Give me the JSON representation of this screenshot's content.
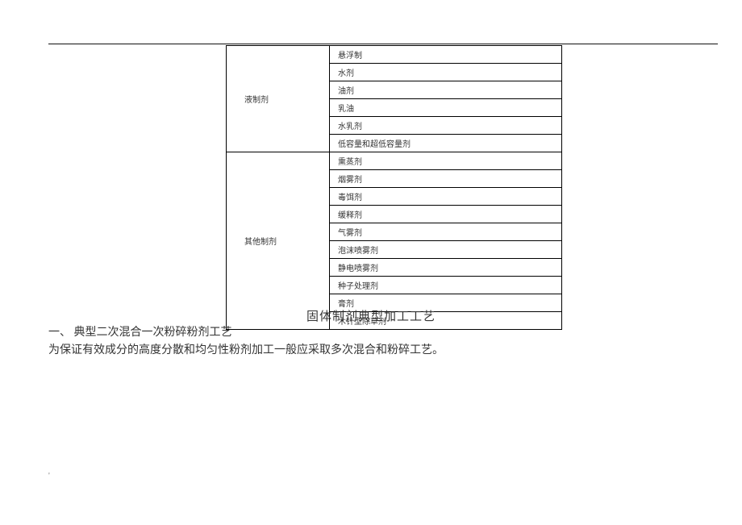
{
  "table": {
    "groups": [
      {
        "label": "液制剂",
        "items": [
          "悬浮制",
          "水剂",
          "油剂",
          "乳油",
          "水乳剂",
          "低容量和超低容量剂"
        ]
      },
      {
        "label": "其他制剂",
        "items": [
          "熏蒸剂",
          "烟雾剂",
          "毒饵剂",
          "缓释剂",
          "气雾剂",
          "泡沫喷雾剂",
          "静电喷雾剂",
          "种子处理剂",
          "膏剂",
          "木针型除草剂"
        ]
      }
    ]
  },
  "section_title": "固体制剂典型加工工艺",
  "body": {
    "line1_prefix": "一、",
    "line1_text": "典型二次混合一次粉碎粉剂工艺",
    "line2": "为保证有效成分的高度分散和均匀性粉剂加工一般应采取多次混合和粉碎工艺。"
  },
  "bottom_mark": "'"
}
